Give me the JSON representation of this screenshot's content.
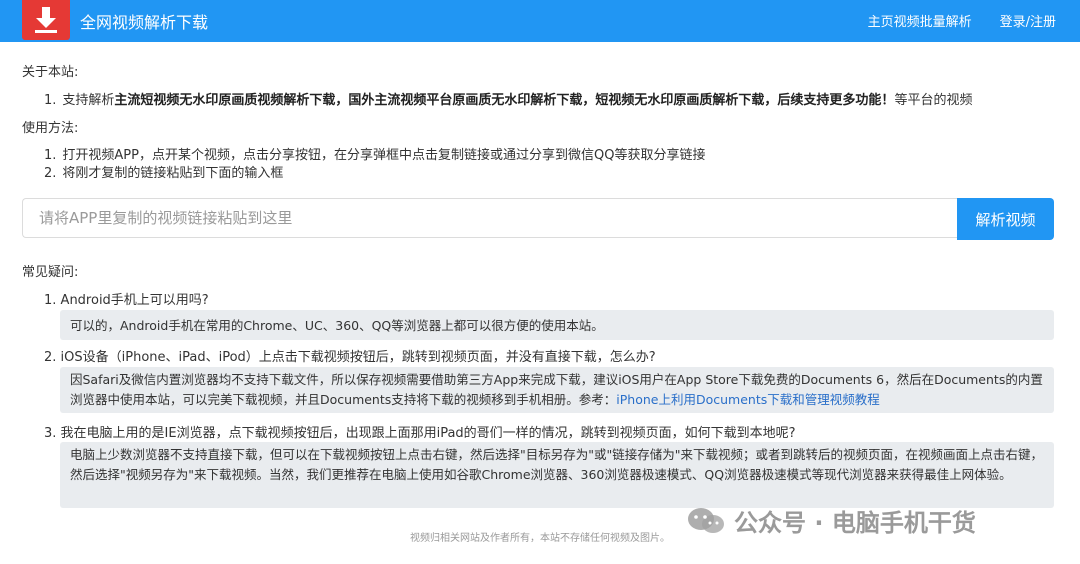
{
  "header": {
    "brand": "全网视频解析下载",
    "nav": {
      "batch": "主页视频批量解析",
      "login": "登录/注册"
    }
  },
  "about": {
    "title": "关于本站:",
    "items": [
      {
        "num": "1.",
        "prefix": "支持解析",
        "bold": "主流短视频无水印原画质视频解析下载，国外主流视频平台原画质无水印解析下载，短视频无水印原画质解析下载，后续支持更多功能！",
        "suffix": "等平台的视频"
      }
    ]
  },
  "usage": {
    "title": "使用方法:",
    "items": [
      {
        "num": "1.",
        "text": "打开视频APP，点开某个视频，点击分享按钮，在分享弹框中点击复制链接或通过分享到微信QQ等获取分享链接"
      },
      {
        "num": "2.",
        "text": "将刚才复制的链接粘贴到下面的输入框"
      }
    ]
  },
  "search": {
    "placeholder": "请将APP里复制的视频链接粘贴到这里",
    "button": "解析视频"
  },
  "faq": {
    "title": "常见疑问:",
    "items": [
      {
        "num": "1.",
        "question": "Android手机上可以用吗?",
        "answer": "可以的，Android手机在常用的Chrome、UC、360、QQ等浏览器上都可以很方便的使用本站。"
      },
      {
        "num": "2.",
        "question": "iOS设备（iPhone、iPad、iPod）上点击下载视频按钮后，跳转到视频页面，并没有直接下载，怎么办?",
        "answer": "因Safari及微信内置浏览器均不支持下载文件，所以保存视频需要借助第三方App来完成下载，建议iOS用户在App Store下载免费的Documents 6，然后在Documents的内置浏览器中使用本站，可以完美下载视频，并且Documents支持将下载的视频移到手机相册。参考：",
        "link": "iPhone上利用Documents下载和管理视频教程"
      },
      {
        "num": "3.",
        "question": "我在电脑上用的是IE浏览器，点下载视频按钮后，出现跟上面那用iPad的哥们一样的情况，跳转到视频页面，如何下载到本地呢?",
        "answer": "电脑上少数浏览器不支持直接下载，但可以在下载视频按钮上点击右键，然后选择\"目标另存为\"或\"链接存储为\"来下载视频；或者到跳转后的视频页面，在视频画面上点击右键，然后选择\"视频另存为\"来下载视频。当然，我们更推荐在电脑上使用如谷歌Chrome浏览器、360浏览器极速模式、QQ浏览器极速模式等现代浏览器来获得最佳上网体验。"
      }
    ]
  },
  "footer": {
    "text": "视频归相关网站及作者所有，本站不存储任何视频及图片。"
  },
  "watermark": {
    "text": "公众号 · 电脑手机干货",
    "icon": "wechat-icon"
  },
  "colors": {
    "primary": "#2196f3",
    "logo": "#e53935",
    "answer_bg": "#e9ecef",
    "link": "#2a6fc9"
  }
}
